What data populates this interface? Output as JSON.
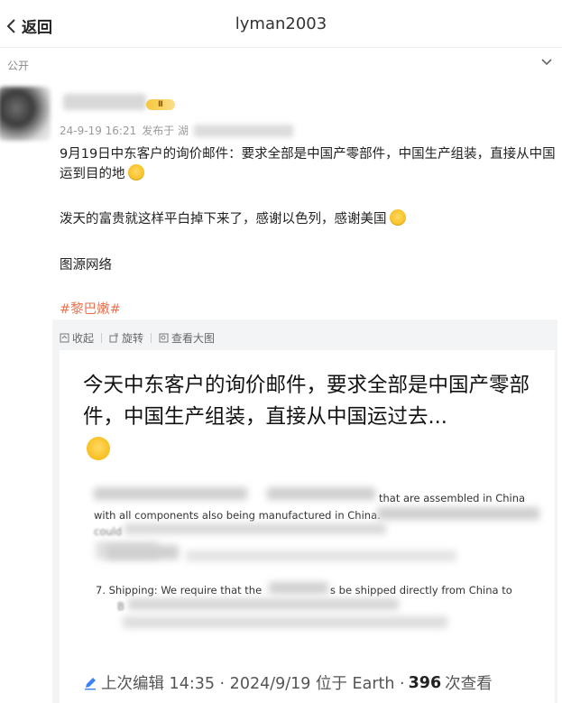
{
  "header": {
    "back_label": "返回",
    "title": "lyman2003"
  },
  "visibility": {
    "label": "公开"
  },
  "post": {
    "vip_badge": "Ⅱ",
    "date": "24-9-19 16:21",
    "posted_from": "发布于 湖",
    "paragraphs": [
      "9月19日中东客户的询价邮件：要求全部是中国产零部件，中国生产组装，直接从中国运到目的地",
      "泼天的富贵就这样平白掉下来了，感谢以色列，感谢美国",
      "图源网络"
    ],
    "hashtag": "#黎巴嫩#"
  },
  "toolbar": {
    "collapse": "收起",
    "rotate": "旋转",
    "view_large": "查看大图"
  },
  "image": {
    "headline": "今天中东客户的询价邮件，要求全部是中国产零部件，中国生产组装，直接从中国运过去...",
    "email_line1": "that are assembled in China",
    "email_line2": "with all components also being manufactured in China.",
    "email_line3": "could",
    "email_line4_prefix": "7. Shipping: We require that the",
    "email_line4_suffix": "s be shipped directly from China to",
    "email_line5": "B",
    "footer_prefix": "上次编辑 14:35 · 2024/9/19 位于 Earth ·",
    "footer_count": "396",
    "footer_suffix": "次查看"
  }
}
